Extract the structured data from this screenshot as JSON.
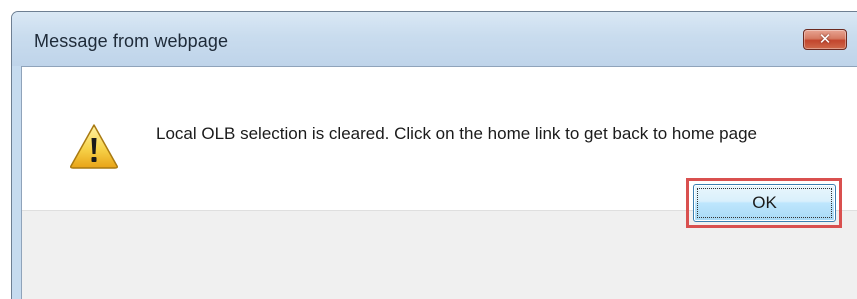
{
  "dialog": {
    "title": "Message from webpage",
    "close_icon": "close-icon",
    "warning_icon": "warning-icon",
    "message": "Local OLB selection is cleared. Click on the home link to get back to home page",
    "ok_label": "OK"
  },
  "colors": {
    "titlebar": "#c9dcee",
    "close_button": "#c2452d",
    "highlight_border": "#d9504f",
    "ok_button": "#bee6fd"
  }
}
